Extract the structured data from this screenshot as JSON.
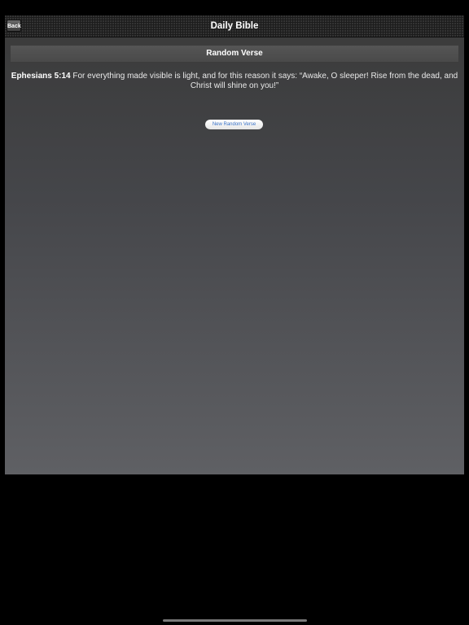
{
  "navbar": {
    "title": "Daily Bible",
    "back_label": "Back"
  },
  "section": {
    "header": "Random Verse"
  },
  "verse": {
    "reference": "Ephesians 5:14",
    "text": "For everything made visible is light, and for this reason it says: “Awake, O sleeper! Rise from the dead, and Christ will shine on you!”"
  },
  "actions": {
    "new_random_label": "New Random Verse"
  },
  "colors": {
    "background": "#000000",
    "navbar": "#1c1c1c",
    "content_top": "#3a3a3a",
    "content_bottom": "#5f6064",
    "button_text": "#3b74c9"
  }
}
